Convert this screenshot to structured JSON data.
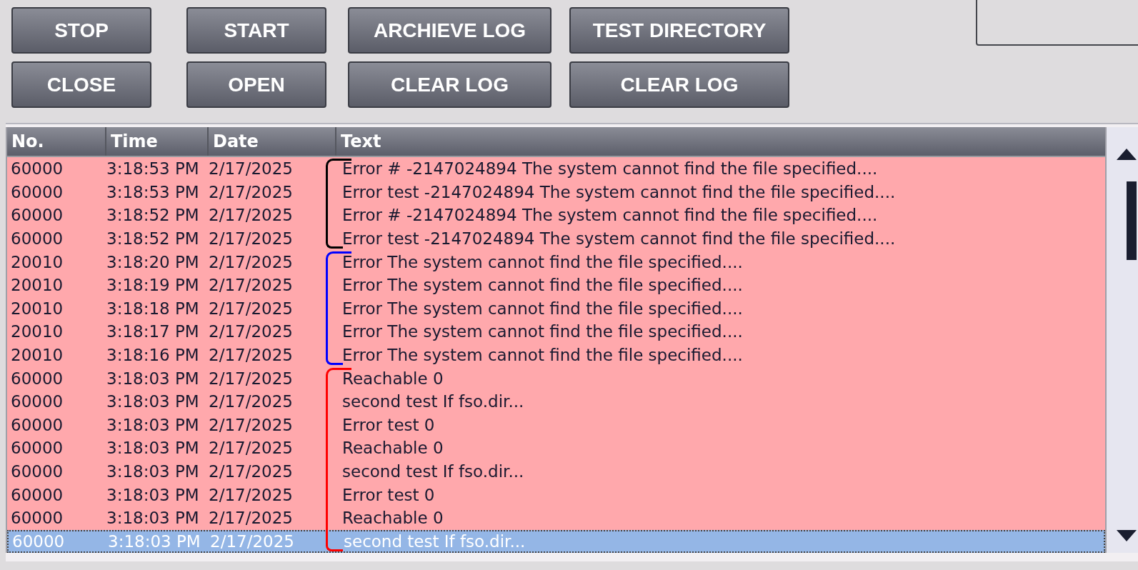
{
  "buttons": [
    {
      "label": "STOP"
    },
    {
      "label": "START"
    },
    {
      "label": "ARCHIEVE LOG"
    },
    {
      "label": "TEST DIRECTORY"
    },
    {
      "label": "CLOSE"
    },
    {
      "label": "OPEN"
    },
    {
      "label": "CLEAR LOG"
    },
    {
      "label": "CLEAR LOG"
    }
  ],
  "table": {
    "columns": [
      "No.",
      "Time",
      "Date",
      "Text"
    ],
    "rows": [
      {
        "no": "60000",
        "time": "3:18:53 PM",
        "date": "2/17/2025",
        "text": "Error # -2147024894 The system cannot find the file specified....",
        "selected": false,
        "bracket": {
          "color": "#000000"
        }
      },
      {
        "no": "60000",
        "time": "3:18:53 PM",
        "date": "2/17/2025",
        "text": "Error test -2147024894 The system cannot find the file specified....",
        "selected": false,
        "bracket": {
          "color": "#000000"
        }
      },
      {
        "no": "60000",
        "time": "3:18:52 PM",
        "date": "2/17/2025",
        "text": "Error # -2147024894 The system cannot find the file specified....",
        "selected": false,
        "bracket": {
          "color": "#000000"
        }
      },
      {
        "no": "60000",
        "time": "3:18:52 PM",
        "date": "2/17/2025",
        "text": "Error test -2147024894 The system cannot find the file specified....",
        "selected": false,
        "bracket": {
          "color": "#000000"
        }
      },
      {
        "no": "20010",
        "time": "3:18:20 PM",
        "date": "2/17/2025",
        "text": "Error The system cannot find the file specified....",
        "selected": false,
        "bracket": {
          "color": "#0000ff"
        }
      },
      {
        "no": "20010",
        "time": "3:18:19 PM",
        "date": "2/17/2025",
        "text": "Error The system cannot find the file specified....",
        "selected": false,
        "bracket": {
          "color": "#0000ff"
        }
      },
      {
        "no": "20010",
        "time": "3:18:18 PM",
        "date": "2/17/2025",
        "text": "Error The system cannot find the file specified....",
        "selected": false,
        "bracket": {
          "color": "#0000ff"
        }
      },
      {
        "no": "20010",
        "time": "3:18:17 PM",
        "date": "2/17/2025",
        "text": "Error The system cannot find the file specified....",
        "selected": false,
        "bracket": {
          "color": "#0000ff"
        }
      },
      {
        "no": "20010",
        "time": "3:18:16 PM",
        "date": "2/17/2025",
        "text": "Error The system cannot find the file specified....",
        "selected": false,
        "bracket": {
          "color": "#0000ff"
        }
      },
      {
        "no": "60000",
        "time": "3:18:03 PM",
        "date": "2/17/2025",
        "text": "Reachable 0",
        "selected": false,
        "bracket": {
          "color": "#ff0000"
        }
      },
      {
        "no": "60000",
        "time": "3:18:03 PM",
        "date": "2/17/2025",
        "text": "second test If fso.dir...",
        "selected": false,
        "bracket": {
          "color": "#ff0000"
        }
      },
      {
        "no": "60000",
        "time": "3:18:03 PM",
        "date": "2/17/2025",
        "text": "Error test 0",
        "selected": false,
        "bracket": {
          "color": "#ff0000"
        }
      },
      {
        "no": "60000",
        "time": "3:18:03 PM",
        "date": "2/17/2025",
        "text": "Reachable 0",
        "selected": false,
        "bracket": {
          "color": "#ff0000"
        }
      },
      {
        "no": "60000",
        "time": "3:18:03 PM",
        "date": "2/17/2025",
        "text": "second test If fso.dir...",
        "selected": false,
        "bracket": {
          "color": "#ff0000"
        }
      },
      {
        "no": "60000",
        "time": "3:18:03 PM",
        "date": "2/17/2025",
        "text": "Error test 0",
        "selected": false,
        "bracket": {
          "color": "#ff0000"
        }
      },
      {
        "no": "60000",
        "time": "3:18:03 PM",
        "date": "2/17/2025",
        "text": "Reachable 0",
        "selected": false,
        "bracket": {
          "color": "#ff0000"
        }
      },
      {
        "no": "60000",
        "time": "3:18:03 PM",
        "date": "2/17/2025",
        "text": "second test If fso.dir...",
        "selected": true,
        "bracket": {
          "color": "#ff0000"
        }
      }
    ]
  }
}
